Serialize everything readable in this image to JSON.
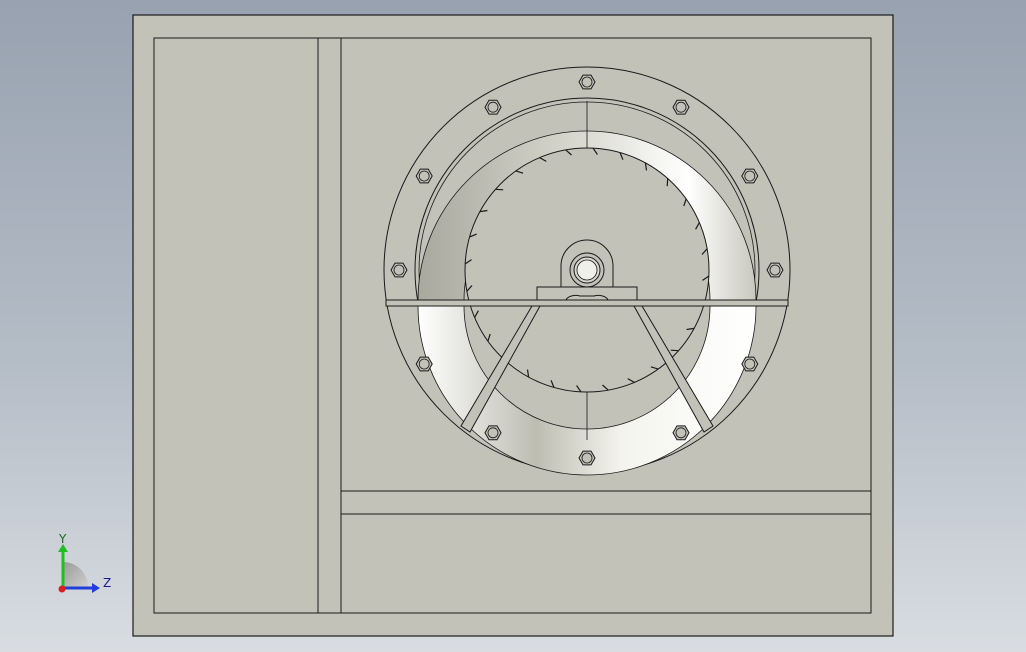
{
  "viewport": {
    "background_top": "#98a2b0",
    "background_bottom": "#d9dde2"
  },
  "drawing": {
    "sheet_fill": "#c2c2b8",
    "line_color": "#1a1a1a",
    "bolt_count": 12
  },
  "triad": {
    "y_label": "Y",
    "z_label": "Z",
    "y_color": "#1fbf1f",
    "z_color": "#1f3fd8",
    "x_color": "#d81f1f"
  }
}
